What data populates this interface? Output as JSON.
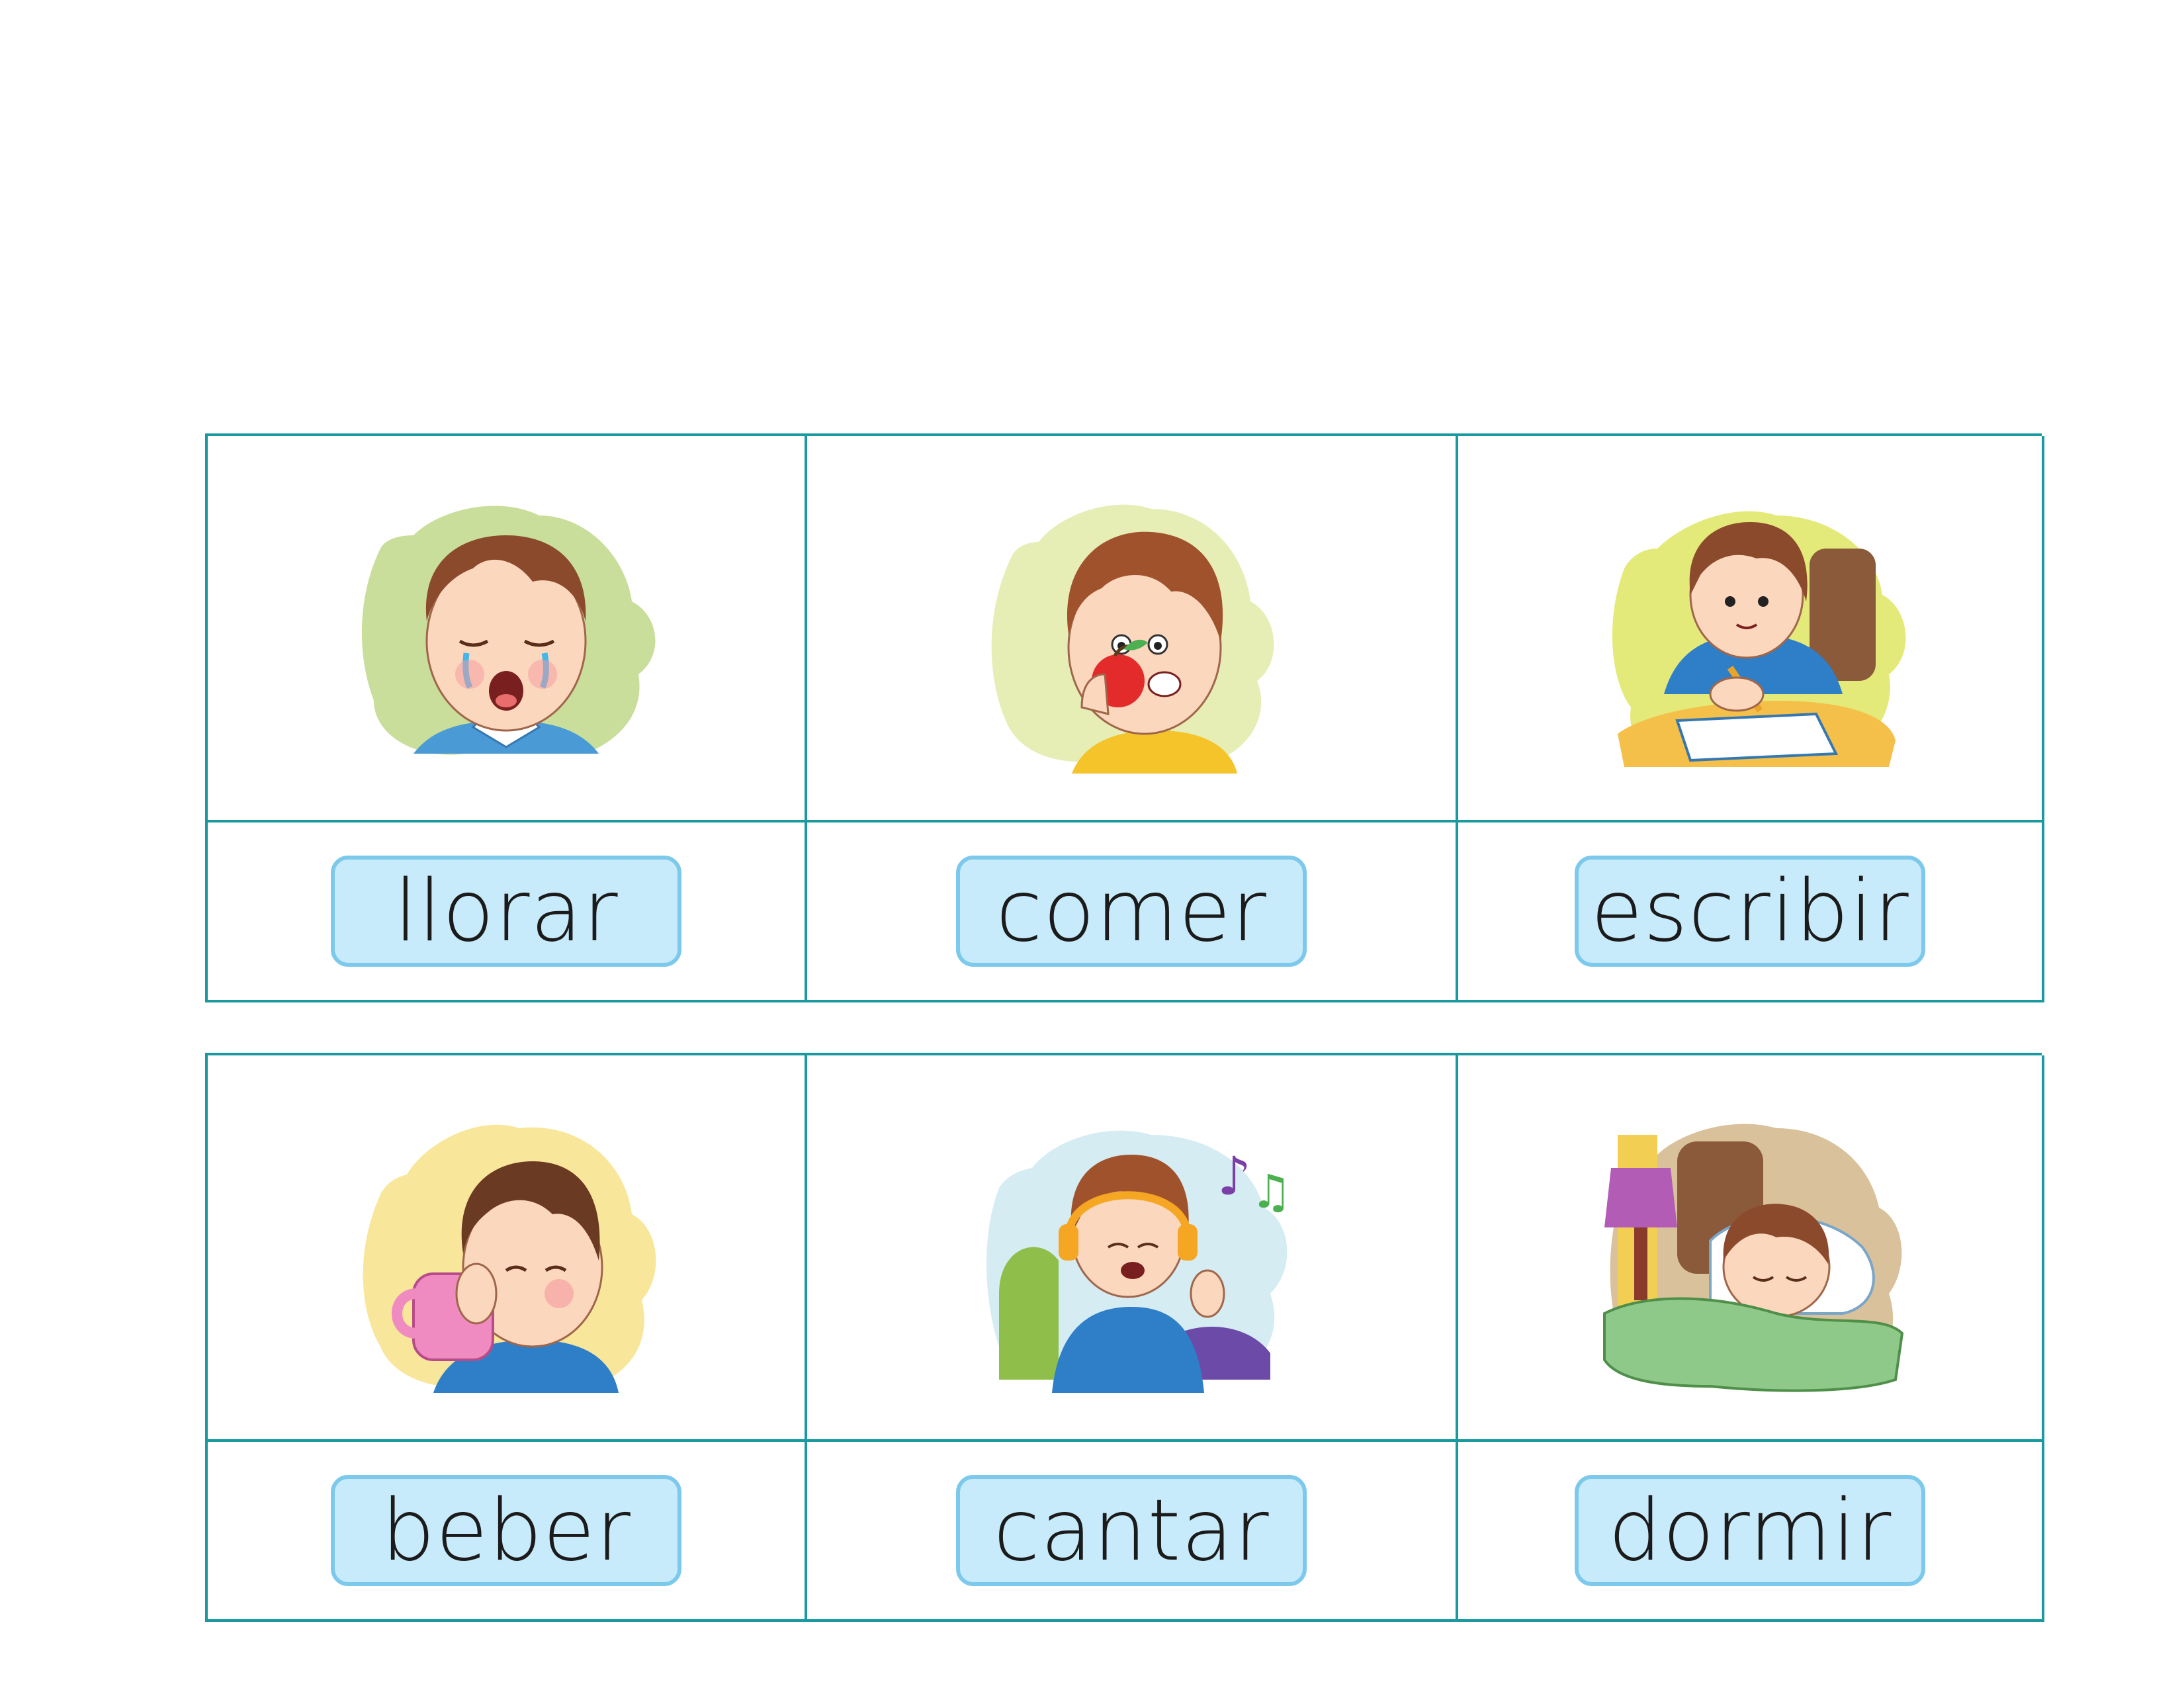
{
  "cards": [
    {
      "word": "llorar",
      "icon": "crying-boy-icon",
      "bg": "#c9de9a"
    },
    {
      "word": "comer",
      "icon": "boy-eating-apple-icon",
      "bg": "#e6eeb6"
    },
    {
      "word": "escribir",
      "icon": "girl-writing-icon",
      "bg": "#e4ea7a"
    },
    {
      "word": "beber",
      "icon": "boy-drinking-icon",
      "bg": "#f8e69a"
    },
    {
      "word": "cantar",
      "icon": "girl-singing-icon",
      "bg": "#d5ecf3"
    },
    {
      "word": "dormir",
      "icon": "boy-sleeping-icon",
      "bg": "#d9c19b"
    }
  ],
  "colors": {
    "border": "#1a9aa0",
    "label_fill": "#c8ebfb",
    "label_border": "#7cc9ec"
  }
}
